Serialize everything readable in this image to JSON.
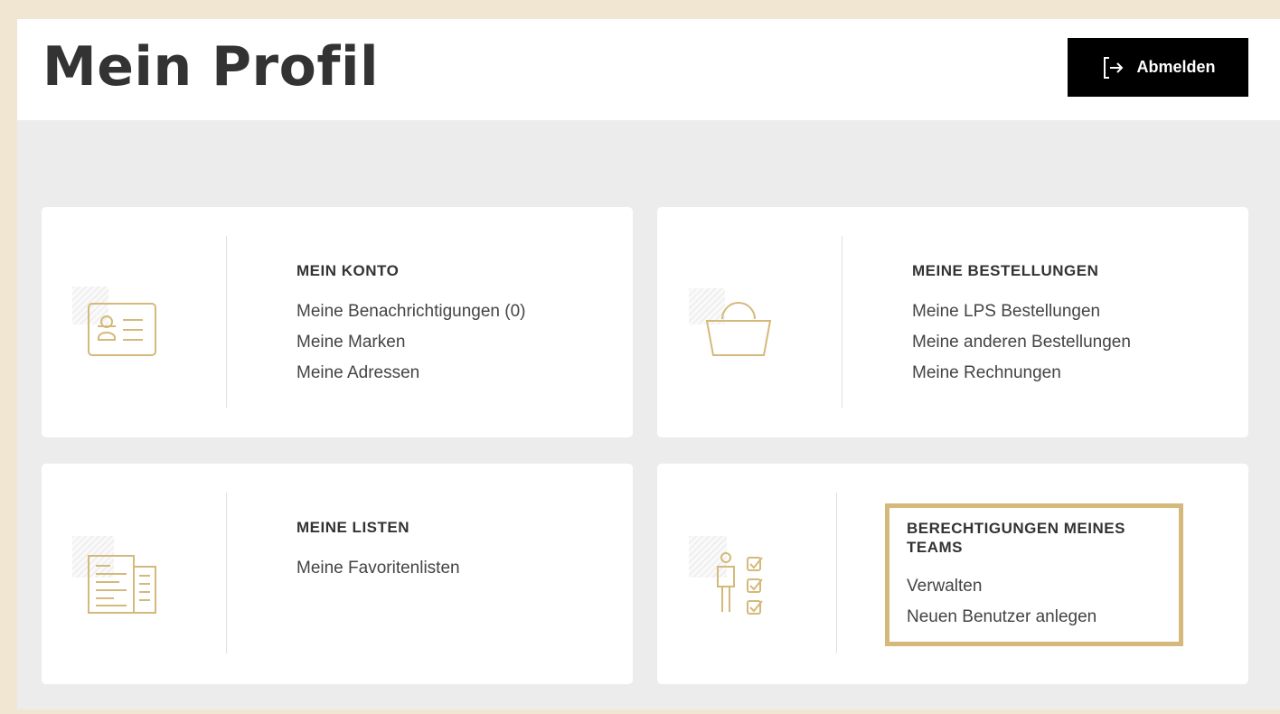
{
  "header": {
    "title": "Mein Profil",
    "logout_label": "Abmelden"
  },
  "cards": [
    {
      "title": "MEIN KONTO",
      "icon": "id-card-icon",
      "links": [
        "Meine Benachrichtigungen (0)",
        "Meine Marken",
        "Meine Adressen"
      ]
    },
    {
      "title": "MEINE BESTELLUNGEN",
      "icon": "shopping-basket-icon",
      "links": [
        "Meine LPS Bestellungen",
        "Meine anderen Bestellungen",
        "Meine Rechnungen"
      ]
    },
    {
      "title": "MEINE LISTEN",
      "icon": "documents-list-icon",
      "links": [
        "Meine Favoritenlisten"
      ]
    },
    {
      "title": "BERECHTIGUNGEN MEINES TEAMS",
      "icon": "user-checklist-icon",
      "links": [
        "Verwalten",
        "Neuen Benutzer anlegen"
      ]
    }
  ],
  "colors": {
    "accent": "#d4b97a",
    "background": "#ececec",
    "outer_border": "#f0e6d2",
    "button": "#000000"
  }
}
